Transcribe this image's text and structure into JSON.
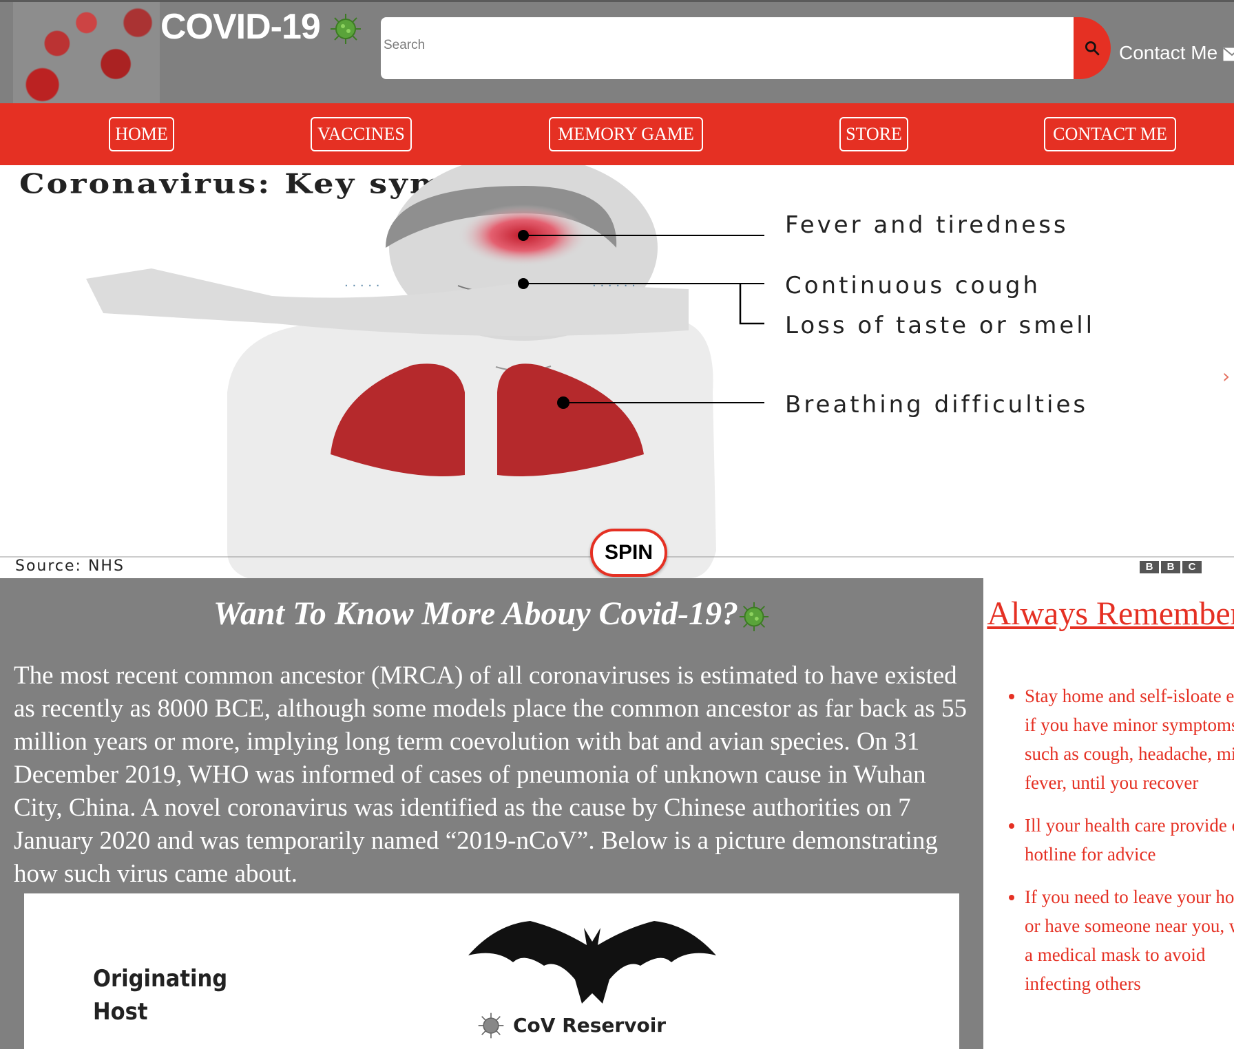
{
  "header": {
    "brand": "COVID-19",
    "search_placeholder": "Search",
    "contact_label": "Contact Me"
  },
  "nav": {
    "items": [
      "HOME",
      "VACCINES",
      "MEMORY GAME",
      "STORE",
      "CONTACT ME"
    ]
  },
  "symptoms_image": {
    "title": "Coronavirus: Key symptoms",
    "labels": [
      "Fever and tiredness",
      "Continuous cough",
      "Loss of taste or smell",
      "Breathing difficulties"
    ],
    "source": "Source: NHS",
    "logo": [
      "B",
      "B",
      "C"
    ]
  },
  "spin_button": "SPIN",
  "article": {
    "heading": "Want To Know More Abouy Covid-19?",
    "body": "The most recent common ancestor (MRCA) of all coronaviruses is estimated to have existed as recently as 8000 BCE, although some models place the common ancestor as far back as 55 million years or more, implying long term coevolution with bat and avian species. On 31 December 2019, WHO was informed of cases of pneumonia of unknown cause in Wuhan City, China. A novel coronavirus was identified as the cause by Chinese authorities on 7 January 2020 and was temporarily named “2019-nCoV”. Below is a picture demonstrating how such virus came about.",
    "image_labels": {
      "host_line1": "Originating",
      "host_line2": "Host",
      "reservoir": "CoV Reservoir"
    }
  },
  "aside": {
    "heading": "Always Remember!",
    "tips": [
      "Stay home and self-isloate even if you have minor symptoms such as cough, headache, mild fever, until you recover",
      "Ill your health care provide or hotline for advice",
      "If you need to leave your house or have someone near you, wear a medical mask to avoid infecting others"
    ]
  },
  "colors": {
    "accent": "#e53023",
    "header_bg": "#808080",
    "lung": "#b5292c"
  }
}
